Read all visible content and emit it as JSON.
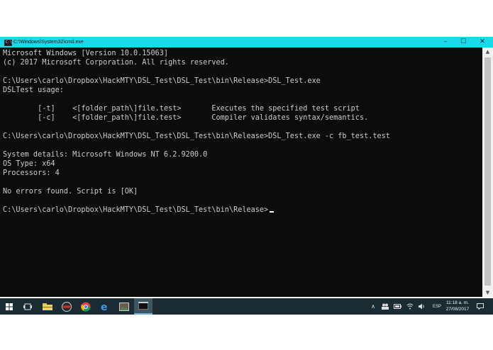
{
  "window": {
    "title": "C:\\Windows\\System32\\cmd.exe",
    "icon": "cmd-icon",
    "buttons": {
      "minimize": "–",
      "maximize": "☐",
      "close": "✕"
    }
  },
  "console": {
    "text": "Microsoft Windows [Version 10.0.15063]\n(c) 2017 Microsoft Corporation. All rights reserved.\n\nC:\\Users\\carlo\\Dropbox\\HackMTY\\DSL_Test\\DSL_Test\\bin\\Release>DSL_Test.exe\nDSLTest usage:\n\n\t[-t]\t<[folder_path\\]file.test>\tExecutes the specified test script\n\t[-c]\t<[folder_path\\]file.test>\tCompiler validates syntax/semantics.\n\nC:\\Users\\carlo\\Dropbox\\HackMTY\\DSL_Test\\DSL_Test\\bin\\Release>DSL_Test.exe -c fb_test.test\n\nSystem details: Microsoft Windows NT 6.2.9200.0\nOS Type: x64\nProcessors: 4\n\nNo errors found. Script is [OK]\n\nC:\\Users\\carlo\\Dropbox\\HackMTY\\DSL_Test\\DSL_Test\\bin\\Release>"
  },
  "scrollbar": {
    "up": "▲",
    "down": "▼"
  },
  "taskbar": {
    "items": [
      "windows-start-icon",
      "task-view-icon",
      "file-explorer-icon",
      "media-player-icon",
      "chrome-icon",
      "edge-icon",
      "photos-icon",
      "cmd-icon"
    ],
    "tray": {
      "language": "ESP",
      "time": "11:18 a. m.",
      "date": "27/08/2017"
    }
  },
  "colors": {
    "titlebar": "#1ad9e8",
    "console_bg": "#0c0c0c",
    "console_text": "#cccccc",
    "taskbar": "#1a2b34"
  }
}
